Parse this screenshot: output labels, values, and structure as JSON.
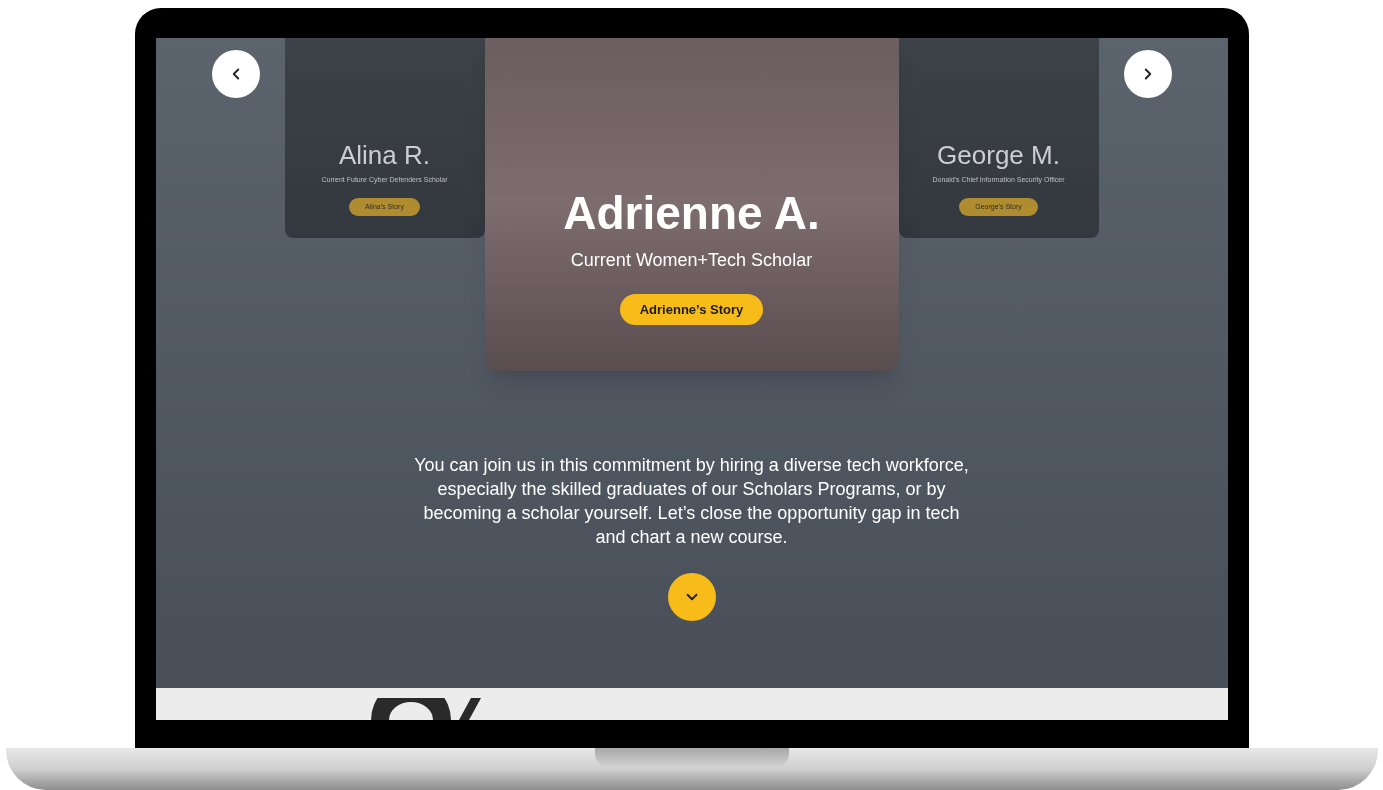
{
  "carousel": {
    "slides": [
      {
        "name": "Alina R.",
        "subtitle": "Current Future Cyber Defenders Scholar",
        "button": "Alina’s Story",
        "selected": false
      },
      {
        "name": "Adrienne A.",
        "subtitle": "Current Women+Tech Scholar",
        "button": "Adrienne’s Story",
        "selected": true
      },
      {
        "name": "George M.",
        "subtitle": "Donald’s Chief Information Security Officer",
        "button": "George’s Story",
        "selected": false
      }
    ]
  },
  "paragraph": "You can join us in this commitment by hiring a diverse tech workforce, especially the skilled graduates of our Scholars Programs, or by becoming a scholar yourself. Let’s close the opportunity gap in tech and chart a new course."
}
